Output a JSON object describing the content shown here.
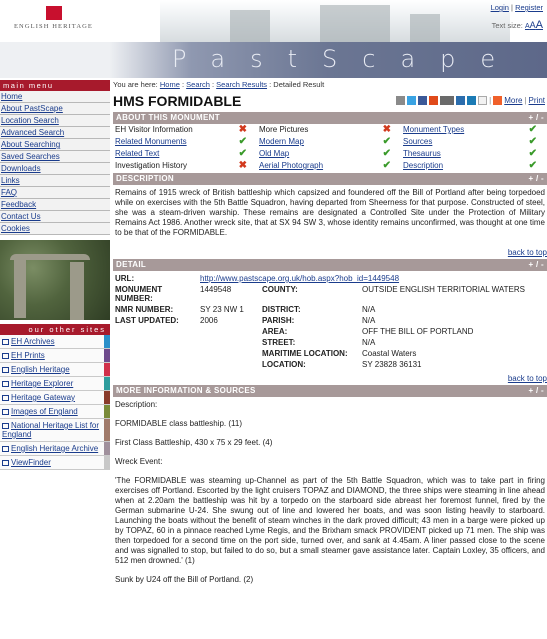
{
  "header": {
    "logo_text": "ENGLISH HERITAGE",
    "login": "Login",
    "register": "Register",
    "textsize_label": "Text size:",
    "textsize_options": [
      "A",
      "A",
      "A"
    ],
    "site_title": "PastScape"
  },
  "sidebar": {
    "main_menu_label": "main menu",
    "menu_items": [
      "Home",
      "About PastScape",
      "Location Search",
      "Advanced Search",
      "About Searching",
      "Saved Searches",
      "Downloads",
      "Links",
      "FAQ",
      "Feedback",
      "Contact Us",
      "Cookies"
    ],
    "other_sites_label": "our other sites",
    "other_sites": [
      {
        "label": "EH Archives",
        "color": "#2a8fc9"
      },
      {
        "label": "EH Prints",
        "color": "#6e4a8c"
      },
      {
        "label": "English Heritage",
        "color": "#d0304a"
      },
      {
        "label": "Heritage Explorer",
        "color": "#2e9d9d"
      },
      {
        "label": "Heritage Gateway",
        "color": "#8a3b2b"
      },
      {
        "label": "Images of England",
        "color": "#7a8b3a"
      },
      {
        "label": "National Heritage List for England",
        "color": "#a07a6a"
      },
      {
        "label": "English Heritage Archive",
        "color": "#a0909c"
      },
      {
        "label": "ViewFinder",
        "color": "#c8c8c8"
      }
    ]
  },
  "breadcrumb": {
    "prefix": "You are here:",
    "home": "Home",
    "search": "Search",
    "results": "Search Results",
    "current": ": Detailed Result"
  },
  "page_title": "HMS FORMIDABLE",
  "share": {
    "more": "More",
    "print": "Print"
  },
  "about": {
    "heading": "ABOUT THIS MONUMENT",
    "toggle": "+ / -",
    "items": [
      {
        "label": "EH Visitor Information",
        "link": false,
        "available": false
      },
      {
        "label": "More Pictures",
        "link": false,
        "available": false
      },
      {
        "label": "Monument Types",
        "link": true,
        "available": true
      },
      {
        "label": "Related Monuments",
        "link": true,
        "available": true
      },
      {
        "label": "Modern Map",
        "link": true,
        "available": true
      },
      {
        "label": "Sources",
        "link": true,
        "available": true
      },
      {
        "label": "Related Text",
        "link": true,
        "available": true
      },
      {
        "label": "Old Map",
        "link": true,
        "available": true
      },
      {
        "label": "Thesaurus",
        "link": true,
        "available": true
      },
      {
        "label": "Investigation History",
        "link": false,
        "available": false
      },
      {
        "label": "Aerial Photograph",
        "link": true,
        "available": true
      },
      {
        "label": "Description",
        "link": true,
        "available": true
      }
    ]
  },
  "description": {
    "heading": "DESCRIPTION",
    "toggle": "+ / -",
    "text": "Remains of 1915 wreck of British battleship which capsized and foundered off the Bill of Portland after being torpedoed while on exercises with the 5th Battle Squadron, having departed from Sheerness for that purpose. Constructed of steel, she was a steam-driven warship. These remains are designated a Controlled Site under the Protection of Military Remains Act 1986. Another wreck site, that at SX 94 SW 3, whose identity remains unconfirmed, was thought at one time to be that of the FORMIDABLE.",
    "back_to_top": "back to top"
  },
  "detail": {
    "heading": "DETAIL",
    "toggle": "+ / -",
    "url_label": "URL:",
    "url": "http://www.pastscape.org.uk/hob.aspx?hob_id=1449548",
    "monument_number_label": "MONUMENT NUMBER:",
    "monument_number": "1449548",
    "county_label": "COUNTY:",
    "county": "OUTSIDE ENGLISH TERRITORIAL WATERS",
    "nmr_label": "NMR NUMBER:",
    "nmr": "SY 23 NW 1",
    "district_label": "DISTRICT:",
    "district": "N/A",
    "last_updated_label": "LAST UPDATED:",
    "last_updated": "2006",
    "parish_label": "PARISH:",
    "parish": "N/A",
    "area_label": "AREA:",
    "area": "OFF THE BILL OF PORTLAND",
    "street_label": "STREET:",
    "street": "N/A",
    "maritime_label": "MARITIME LOCATION:",
    "maritime": "Coastal Waters",
    "location_label": "LOCATION:",
    "location": "SY 23828 36131",
    "back_to_top": "back to top"
  },
  "more_info": {
    "heading": "MORE INFORMATION & SOURCES",
    "toggle": "+ / -",
    "paragraphs": [
      "Description:",
      "FORMIDABLE class battleship. (11)",
      "First Class Battleship, 430 x 75 x 29 feet. (4)",
      "Wreck Event:",
      "'The FORMIDABLE was steaming up-Channel as part of the 5th Battle Squadron, which was to take part in firing exercises off Portland. Escorted by the light cruisers TOPAZ and DIAMOND, the three ships were steaming in line ahead when at 2.20am the battleship was hit by a torpedo on the starboard side abreast her foremost funnel, fired by the German submarine U-24. She swung out of line and lowered her boats, and was soon listing heavily to starboard. Launching the boats without the benefit of steam winches in the dark proved difficult; 43 men in a barge were picked up by TOPAZ, 60 in a pinnace reached Lyme Regis, and the Brixham smack PROVIDENT picked up 71 men. The ship was then torpedoed for a second time on the port side, turned over, and sank at 4.45am. A liner passed close to the scene and was signalled to stop, but failed to do so, but a small steamer gave assistance later. Captain Loxley, 35 officers, and 512 men drowned.' (1)",
      "Sunk by U24 off the Bill of Portland. (2)"
    ]
  },
  "colors": {
    "brand_red": "#a71a2c",
    "section_header": "#a79999",
    "link": "#1a3c8c",
    "check": "#3a9a2a",
    "cross": "#d23a1e"
  }
}
